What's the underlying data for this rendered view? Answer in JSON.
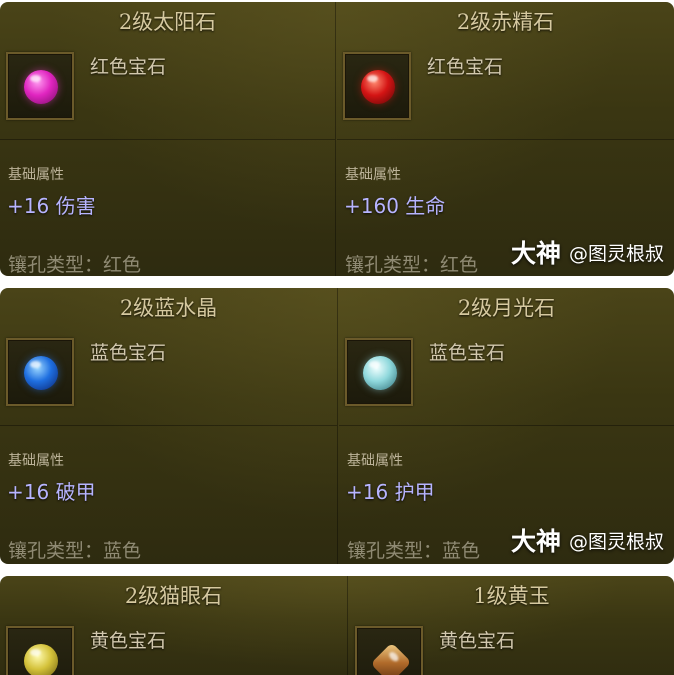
{
  "panels": [
    {
      "cards": [
        {
          "title": "2级太阳石",
          "type": "红色宝石",
          "gem_icon": "magenta-gem-icon",
          "attr_label": "基础属性",
          "attr_value": "+16 伤害",
          "socket": "镶孔类型：红色"
        },
        {
          "title": "2级赤精石",
          "type": "红色宝石",
          "gem_icon": "red-gem-icon",
          "attr_label": "基础属性",
          "attr_value": "+160 生命",
          "socket": "镶孔类型：红色"
        }
      ],
      "watermark": {
        "brand": "大神",
        "user": "@图灵根叔"
      }
    },
    {
      "cards": [
        {
          "title": "2级蓝水晶",
          "type": "蓝色宝石",
          "gem_icon": "blue-gem-icon",
          "attr_label": "基础属性",
          "attr_value": "+16 破甲",
          "socket": "镶孔类型：蓝色"
        },
        {
          "title": "2级月光石",
          "type": "蓝色宝石",
          "gem_icon": "pale-blue-gem-icon",
          "attr_label": "基础属性",
          "attr_value": "+16 护甲",
          "socket": "镶孔类型：蓝色"
        }
      ],
      "watermark": {
        "brand": "大神",
        "user": "@图灵根叔"
      }
    },
    {
      "cards": [
        {
          "title": "2级猫眼石",
          "type": "黄色宝石",
          "gem_icon": "yellow-gem-icon"
        },
        {
          "title": "1级黄玉",
          "type": "黄色宝石",
          "gem_icon": "topaz-gem-icon"
        }
      ]
    }
  ]
}
